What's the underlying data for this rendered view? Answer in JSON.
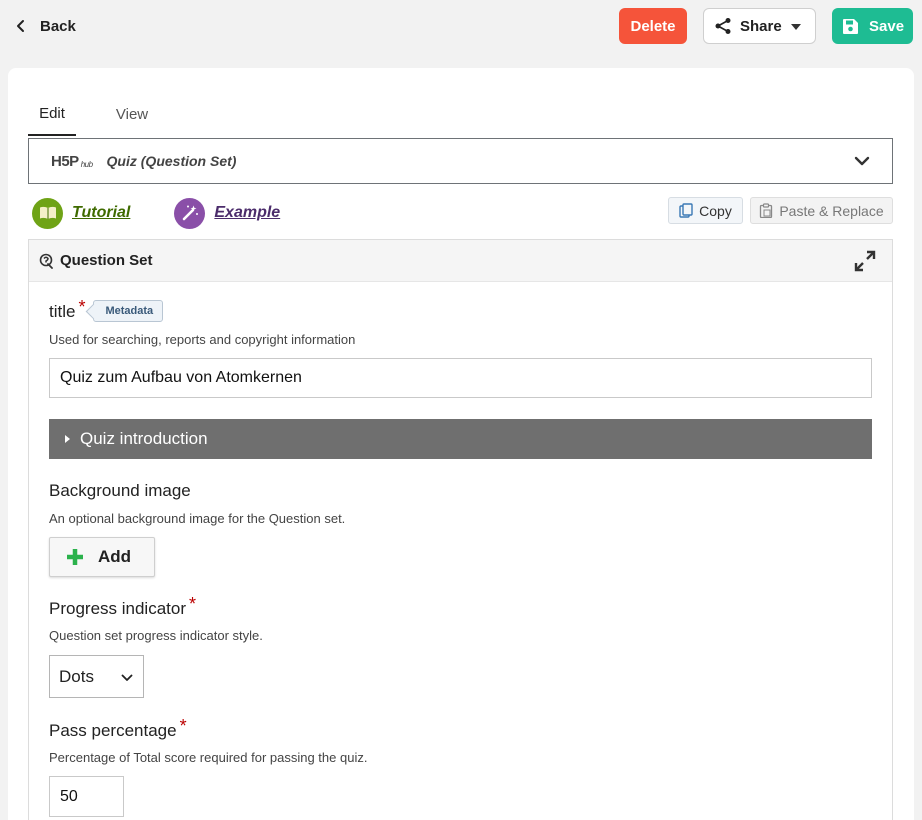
{
  "topbar": {
    "back_label": "Back",
    "delete_label": "Delete",
    "share_label": "Share",
    "save_label": "Save"
  },
  "tabs": [
    {
      "label": "Edit",
      "active": true
    },
    {
      "label": "View",
      "active": false
    }
  ],
  "content_type": {
    "logo_text": "H5P",
    "logo_sub": "hub",
    "title": "Quiz (Question Set)"
  },
  "helpers": {
    "tutorial_label": "Tutorial",
    "example_label": "Example",
    "copy_label": "Copy",
    "paste_label": "Paste & Replace"
  },
  "question_set": {
    "header": "Question Set",
    "title_field": {
      "label": "title",
      "metadata_label": "Metadata",
      "description": "Used for searching, reports and copyright information",
      "value": "Quiz zum Aufbau von Atomkernen"
    },
    "intro_label": "Quiz introduction",
    "background": {
      "label": "Background image",
      "description": "An optional background image for the Question set.",
      "add_label": "Add"
    },
    "progress": {
      "label": "Progress indicator",
      "description": "Question set progress indicator style.",
      "value": "Dots"
    },
    "pass": {
      "label": "Pass percentage",
      "description": "Percentage of Total score required for passing the quiz.",
      "value": "50"
    }
  },
  "colors": {
    "delete": "#f5543a",
    "save": "#1ebc93",
    "tutorial": "#6fa316",
    "example": "#8a4fa8",
    "intro_bar": "#6f6f6f",
    "required": "#bb0000"
  },
  "icons": {
    "back": "chevron-left-icon",
    "share": "share-icon",
    "save": "floppy-disk-icon",
    "selector": "chevron-down-icon",
    "tutorial": "book-icon",
    "example": "magic-wand-icon",
    "copy": "copy-icon",
    "paste": "clipboard-icon",
    "question_set": "question-set-icon",
    "expand": "expand-icon",
    "add": "plus-icon"
  }
}
